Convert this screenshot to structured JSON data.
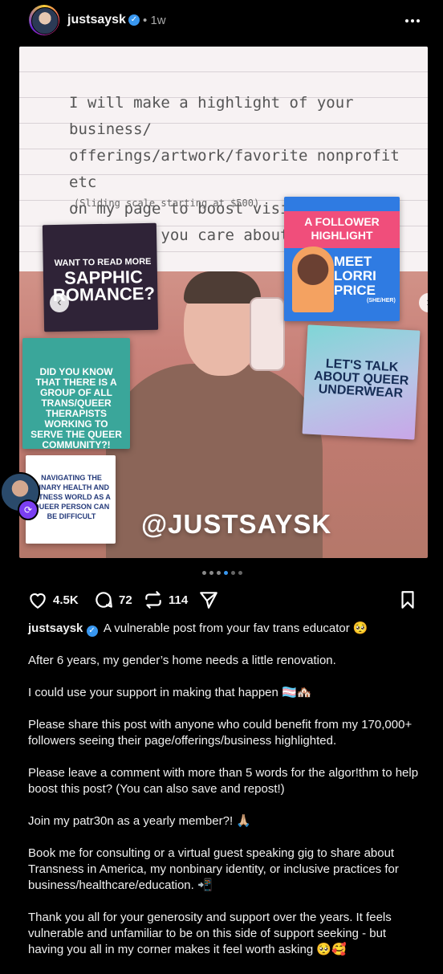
{
  "post_header": {
    "username": "justsaysk",
    "time_ago": "1w",
    "dot_separator": "•"
  },
  "media": {
    "handwriting_lines": [
      "I will make a highlight of your business/",
      "offerings/artwork/favorite nonprofit etc",
      "on my page to boost visibility of",
      "something you care about."
    ],
    "handwriting_sub": "(Sliding scale starting at $500)",
    "watermark": "@JUSTSAYSK",
    "card_sapphic_small": "WANT TO READ MORE",
    "card_sapphic_big": "SAPPHIC ROMANCE?",
    "card_follower_band": "A FOLLOWER HIGHLIGHT",
    "card_follower_meet": "MEET LORRI PRICE",
    "card_follower_pronouns": "(SHE/HER)",
    "card_didyou": "DID YOU KNOW THAT THERE IS A GROUP OF ALL TRANS/QUEER THERAPISTS WORKING TO SERVE THE QUEER COMMUNITY?!",
    "card_underwear": "LET'S TALK ABOUT QUEER UNDERWEAR",
    "card_navigating": "NAVIGATING THE BINARY HEALTH AND FITNESS WORLD AS A QUEER PERSON CAN BE DIFFICULT",
    "carousel_dot_count": 6,
    "carousel_active_index": 3
  },
  "actions": {
    "likes": "4.5K",
    "comments": "72",
    "reposts": "114"
  },
  "caption": {
    "username": "justsaysk",
    "first_line": "A vulnerable post from your fav trans educator 🥺",
    "paragraphs": [
      "After 6 years, my gender’s home needs a little renovation.",
      "I could use your support in making that happen 🏳️‍⚧️🏘️",
      "Please share this post with anyone who could benefit from my 170,000+ followers seeing their page/offerings/business highlighted.",
      "Please leave a comment with more than 5 words for the algor!thm to help boost this post? (You can also save and repost!)",
      "Join my patr30n as a yearly member?! 🙏🏼",
      "Book me for consulting or a virtual guest speaking gig to share about Transness in America, my nonbinary identity, or inclusive practices for business/healthcare/education. 📲",
      "Thank you all for your generosity and support over the years. It feels vulnerable and unfamiliar to be on this side of support seeking - but having you all in my corner makes it feel worth asking 🥺🥰"
    ]
  }
}
